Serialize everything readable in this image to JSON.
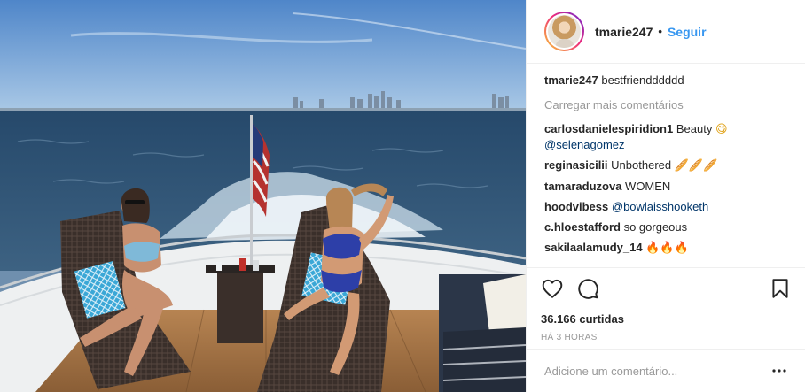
{
  "post": {
    "image_alt": "Two women in swimsuits on lounge chairs on the deck of a boat, with an American flag, open water and a city skyline behind them"
  },
  "header": {
    "username": "tmarie247",
    "separator": "•",
    "follow_label": "Seguir",
    "avatar_icon": "profile-avatar"
  },
  "caption": {
    "username": "tmarie247",
    "text": "bestfriendddddd"
  },
  "load_more_label": "Carregar mais comentários",
  "comments": [
    {
      "user": "carlosdanielespiridion1",
      "text": "Beauty ",
      "emoji": "😋",
      "mention": "@selenagomez"
    },
    {
      "user": "reginasicilii",
      "text": "Unbothered ",
      "emoji": "🥖🥖🥖"
    },
    {
      "user": "tamaraduzova",
      "text": "WOMEN"
    },
    {
      "user": "hoodvibess",
      "text": "",
      "mention": "@bowlaisshooketh"
    },
    {
      "user": "c.hloestafford",
      "text": "so gorgeous"
    },
    {
      "user": "sakilaalamudy_14",
      "text": "",
      "emoji": "🔥🔥🔥"
    }
  ],
  "actions": {
    "like_icon": "heart-icon",
    "comment_icon": "comment-icon",
    "save_icon": "bookmark-icon"
  },
  "likes_text": "36.166 curtidas",
  "time_text": "HÁ 3 HORAS",
  "add_comment": {
    "placeholder": "Adicione um comentário...",
    "more_icon": "more-options-icon"
  },
  "colors": {
    "accent": "#3897f0",
    "text": "#262626",
    "muted": "#999999",
    "mention": "#003569",
    "border": "#efefef"
  }
}
